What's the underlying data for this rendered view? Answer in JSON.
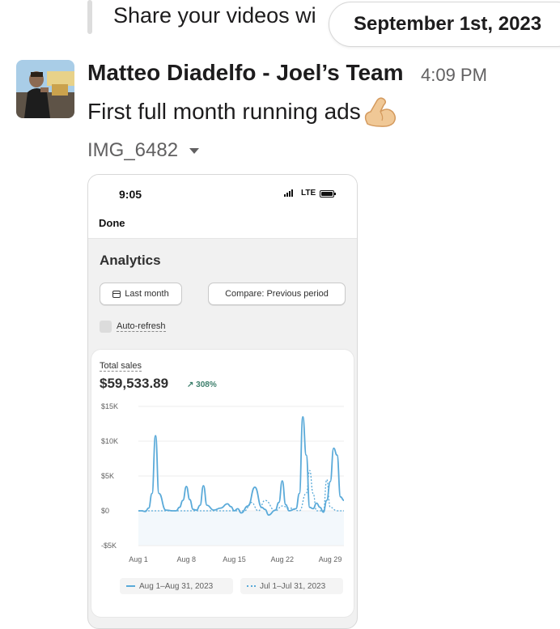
{
  "thread": {
    "quoted_text": "Share your videos wi",
    "date_divider": "September 1st, 2023"
  },
  "message": {
    "author": "Matteo Diadelfo - Joel’s Team",
    "time": "4:09 PM",
    "text": "First full month running ads",
    "emoji": "flexed-biceps",
    "attachment_name": "IMG_6482"
  },
  "screenshot": {
    "status_time": "9:05",
    "network": "LTE",
    "done_label": "Done",
    "title": "Analytics",
    "date_button": "Last month",
    "compare_button": "Compare: Previous period",
    "auto_refresh_label": "Auto-refresh",
    "metric_label": "Total sales",
    "metric_value": "$59,533.89",
    "metric_change": "308%",
    "legend_current": "Aug 1–Aug 31, 2023",
    "legend_previous": "Jul 1–Jul 31, 2023",
    "accent_color": "#5aaad9",
    "positive_color": "#3d7f6c"
  },
  "chart_data": {
    "type": "line",
    "ylim": [
      -5000,
      15000
    ],
    "y_ticks": [
      "$15K",
      "$10K",
      "$5K",
      "$0",
      "-$5K"
    ],
    "y_tick_values": [
      15000,
      10000,
      5000,
      0,
      -5000
    ],
    "x_ticks": [
      "Aug 1",
      "Aug 8",
      "Aug 15",
      "Aug 22",
      "Aug 29"
    ],
    "x_tick_values": [
      1,
      8,
      15,
      22,
      29
    ],
    "xlim": [
      1,
      31
    ],
    "series": [
      {
        "name": "Aug 1–Aug 31, 2023",
        "style": "solid",
        "x": [
          1,
          1.5,
          2,
          2.5,
          3,
          3.5,
          4,
          5,
          6,
          6.5,
          7,
          7.5,
          8,
          8.5,
          9,
          9.5,
          10,
          10.5,
          11,
          12,
          13,
          14,
          14.5,
          15,
          15.5,
          16,
          17,
          18,
          19,
          19.5,
          20,
          21,
          21.5,
          22,
          22.5,
          23,
          24,
          24.5,
          25,
          25.5,
          26,
          26.5,
          27,
          27.5,
          28,
          28.5,
          29,
          29.5,
          30,
          30.5,
          31
        ],
        "y": [
          0,
          0,
          -100,
          400,
          2500,
          10800,
          2500,
          100,
          0,
          0,
          500,
          1500,
          3500,
          1600,
          200,
          100,
          800,
          3600,
          800,
          100,
          400,
          1000,
          600,
          0,
          300,
          -300,
          700,
          3400,
          500,
          200,
          -600,
          100,
          1200,
          4300,
          900,
          0,
          300,
          2500,
          13500,
          8000,
          500,
          300,
          1100,
          500,
          -200,
          1500,
          4200,
          9000,
          8000,
          2000,
          1500
        ]
      },
      {
        "name": "Jul 1–Jul 31, 2023",
        "style": "dotted",
        "x": [
          1,
          3,
          5,
          7,
          9,
          11,
          13,
          15,
          16.5,
          17.5,
          18.5,
          19.5,
          21,
          22,
          23,
          24.5,
          25.5,
          26,
          26.5,
          27,
          28,
          28.5,
          29,
          30,
          31
        ],
        "y": [
          0,
          0,
          0,
          0,
          0,
          0,
          0,
          0,
          0,
          1200,
          0,
          1500,
          0,
          700,
          400,
          0,
          2500,
          5800,
          2500,
          0,
          0,
          4500,
          500,
          0,
          0
        ]
      }
    ]
  }
}
